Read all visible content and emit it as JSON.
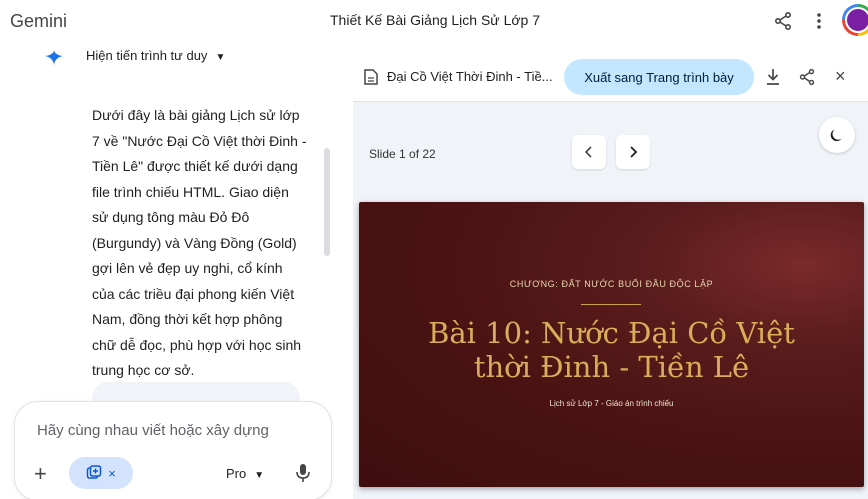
{
  "app": {
    "brand": "Gemini",
    "title": "Thiết Kế Bài Giảng Lịch Sử Lớp 7"
  },
  "chat": {
    "thinking_label": "Hiện tiến trình tư duy",
    "answer_text": "Dưới đây là bài giảng Lịch sử lớp 7 về \"Nước Đại Cồ Việt thời Đinh - Tiền Lê\" được thiết kế dưới dạng file trình chiếu HTML. Giao diện sử dụng tông màu Đỏ Đô (Burgundy) và Vàng Đồng (Gold) gợi lên vẻ đẹp uy nghi, cổ kính của các triều đại phong kiến Việt Nam, đồng thời kết hợp phông chữ dễ đọc, phù hợp với học sinh trung học cơ sở."
  },
  "input": {
    "placeholder": "Hãy cùng nhau viết hoặc xây dựng",
    "model_label": "Pro",
    "tool_chip_close": "×"
  },
  "canvas": {
    "file_title": "Đại Cồ Việt Thời Đinh - Tiề...",
    "export_label": "Xuất sang Trang trình bày",
    "close_glyph": "×",
    "slide_counter": "Slide 1 of 22",
    "slide": {
      "chapter": "CHƯƠNG: ĐẤT NƯỚC BUỔI ĐẦU ĐỘC LẬP",
      "title_line1": "Bài 10: Nước Đại Cồ Việt",
      "title_line2": "thời Đinh - Tiền Lê",
      "subtitle": "Lịch sử Lớp 7 - Giáo án trình chiếu"
    }
  },
  "colors": {
    "accent_blue": "#0b57d0",
    "export_button_bg": "#c2e7ff",
    "slide_bg": "#4a1212",
    "slide_title_gold": "#d9ae5a"
  },
  "icons": [
    "gemini-spark-icon",
    "chevron-down-icon",
    "share-icon",
    "more-vert-icon",
    "plus-icon",
    "canvas-tool-icon",
    "mic-icon",
    "document-icon",
    "download-icon",
    "close-icon",
    "moon-icon",
    "chevron-left-icon",
    "chevron-right-icon"
  ]
}
